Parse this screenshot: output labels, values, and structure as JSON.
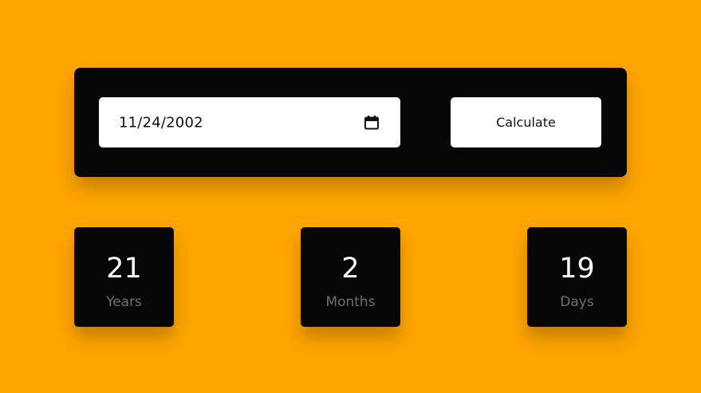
{
  "date_input": {
    "value": "11/24/2002",
    "icon": "calendar-icon"
  },
  "calculate_button": {
    "label": "Calculate"
  },
  "results": [
    {
      "value": "21",
      "label": "Years"
    },
    {
      "value": "2",
      "label": "Months"
    },
    {
      "value": "19",
      "label": "Days"
    }
  ],
  "colors": {
    "background": "#FFA500",
    "panel": "#070707",
    "field": "#FFFFFF",
    "value_text": "#FFFFFF",
    "label_text": "#707070"
  }
}
